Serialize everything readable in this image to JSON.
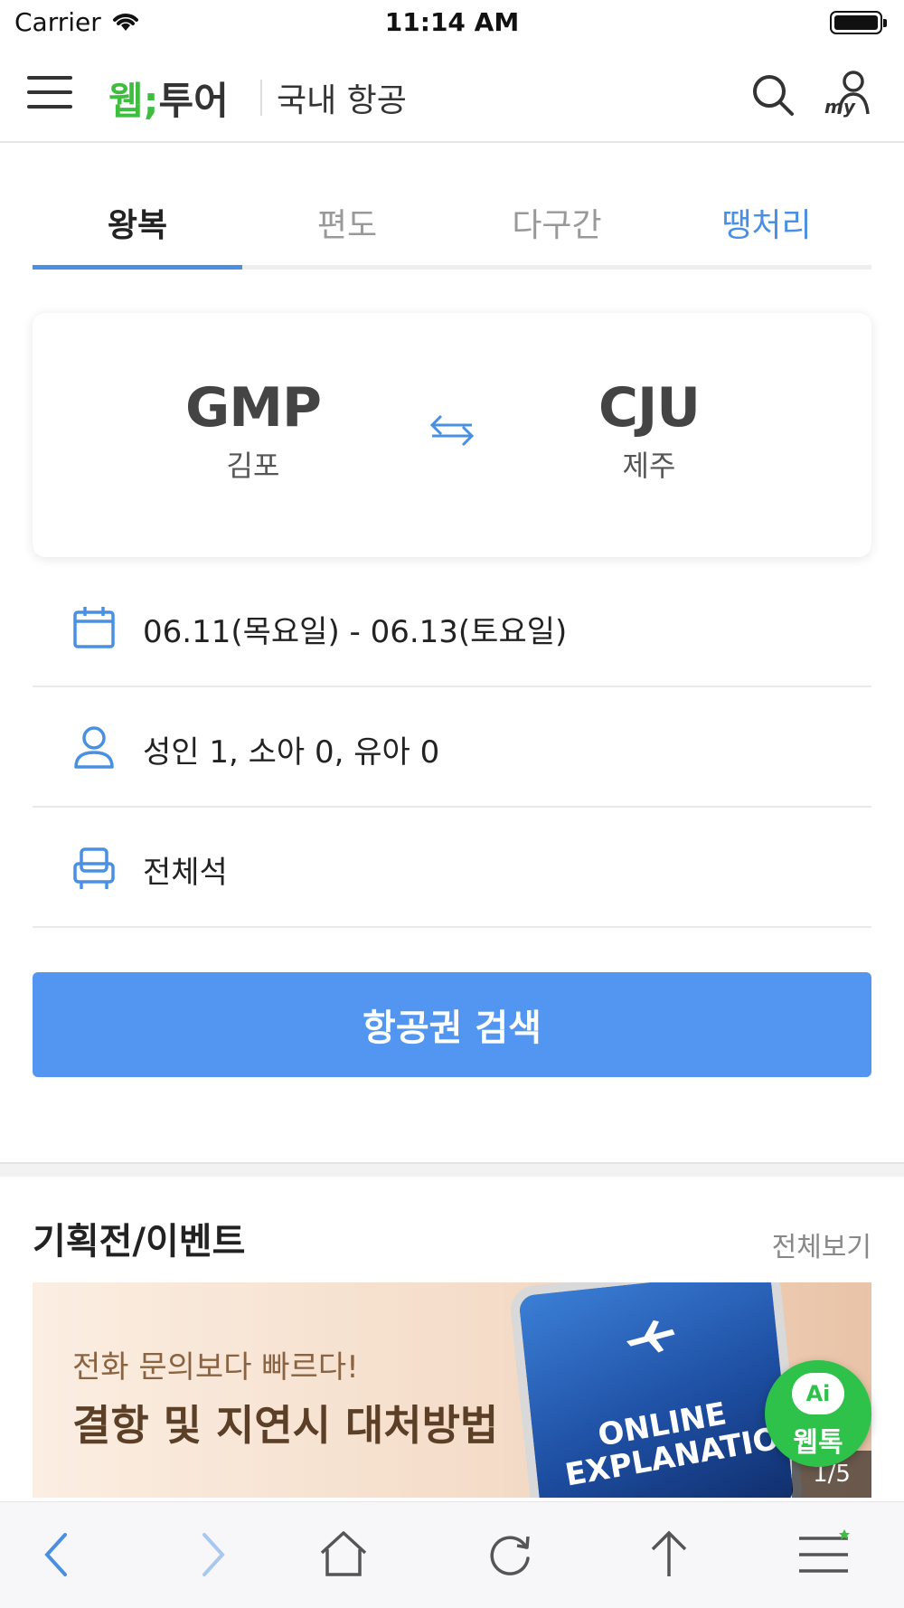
{
  "status_bar": {
    "carrier": "Carrier",
    "time": "11:14 AM"
  },
  "header": {
    "logo_left": "웹",
    "logo_mark": ";",
    "logo_right": "투어",
    "title": "국내 항공",
    "icons": [
      "menu-icon",
      "search-icon",
      "my-page-icon"
    ],
    "my_label": "my"
  },
  "tabs": [
    {
      "label": "왕복",
      "active": true
    },
    {
      "label": "편도",
      "active": false
    },
    {
      "label": "다구간",
      "active": false
    },
    {
      "label": "땡처리",
      "active": false
    }
  ],
  "route": {
    "departure": {
      "code": "GMP",
      "name": "김포"
    },
    "arrival": {
      "code": "CJU",
      "name": "제주"
    }
  },
  "options": {
    "dates": "06.11(목요일)  - 06.13(토요일)",
    "passengers": "성인 1, 소아 0, 유아 0",
    "seat_class": "전체석"
  },
  "search_button": "항공권 검색",
  "events": {
    "title": "기획전/이벤트",
    "view_all": "전체보기",
    "banner": {
      "line1": "전화 문의보다 빠르다!",
      "line2": "결항 및 지연시 대처방법",
      "phone_text": "ONLINE EXPLANATION",
      "pager": "1/5"
    }
  },
  "chat": {
    "badge": "Ai",
    "label": "웹톡"
  },
  "toolbar_icons": [
    "back-icon",
    "forward-icon",
    "home-icon",
    "reload-icon",
    "share-icon",
    "menu-icon"
  ],
  "colors": {
    "accent": "#5396f2",
    "brand_green": "#3ebd3e",
    "tab_special": "#4a90e2",
    "chat_green": "#2ec24a"
  }
}
